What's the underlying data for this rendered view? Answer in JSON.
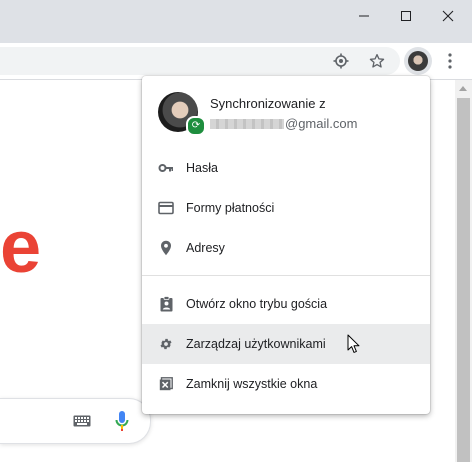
{
  "window": {
    "controls": [
      "minimize-icon",
      "maximize-icon",
      "close-icon"
    ]
  },
  "toolbar": {
    "icons": [
      "location-target-icon",
      "star-icon",
      "avatar",
      "more-vert-icon"
    ]
  },
  "page": {
    "logo_fragment": "e",
    "search_icons": [
      "keyboard-icon",
      "microphone-icon"
    ]
  },
  "profile_menu": {
    "sync_title": "Synchronizowanie z",
    "email_domain": "@gmail.com",
    "items": [
      {
        "label": "Hasła",
        "icon": "key-icon"
      },
      {
        "label": "Formy płatności",
        "icon": "credit-card-icon"
      },
      {
        "label": "Adresy",
        "icon": "location-pin-icon"
      },
      {
        "label": "Otwórz okno trybu gościa",
        "icon": "guest-badge-icon"
      },
      {
        "label": "Zarządzaj użytkownikami",
        "icon": "gear-icon"
      },
      {
        "label": "Zamknij wszystkie okna",
        "icon": "close-window-icon"
      }
    ],
    "hovered_item": "Zarządzaj użytkownikami"
  },
  "colors": {
    "titlebar": "#dee1e6",
    "sync_badge": "#1e8e3e",
    "google_red": "#ea4335",
    "hover_bg": "#eaebec"
  }
}
